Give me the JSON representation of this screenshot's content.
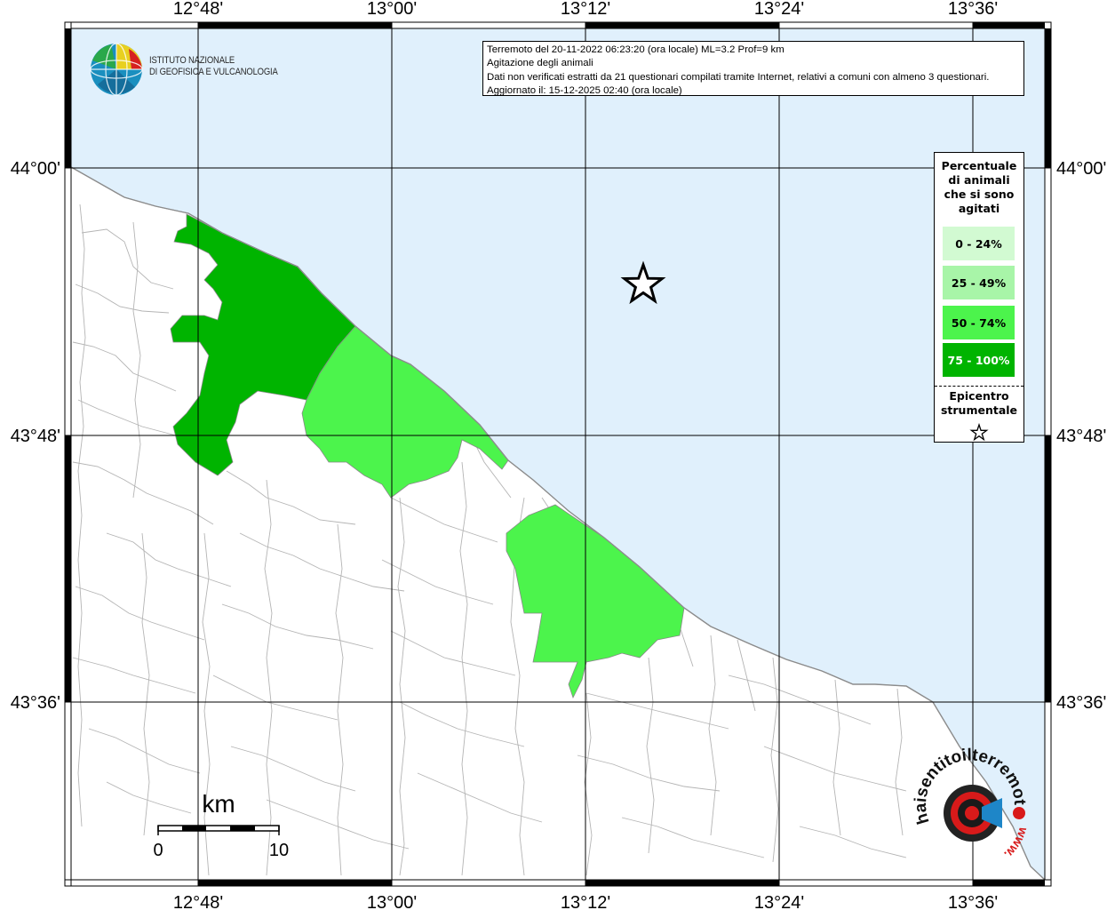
{
  "header": {
    "line1": "Terremoto del 20-11-2022 06:23:20 (ora locale) ML=3.2 Prof=9 km",
    "line2": "Agitazione degli animali",
    "line3": "Dati non verificati estratti da 21 questionari compilati tramite Internet, relativi a comuni con almeno 3 questionari.",
    "line4": "Aggiornato il: 15-12-2025 02:40 (ora locale)"
  },
  "logo": {
    "line1": "ISTITUTO NAZIONALE",
    "line2": "DI GEOFISICA E VULCANOLOGIA"
  },
  "legend": {
    "title_lines": [
      "Percentuale",
      "di animali",
      "che si sono",
      "agitati"
    ],
    "classes": [
      {
        "label": "0 - 24%",
        "color": "#d2fad2"
      },
      {
        "label": "25 - 49%",
        "color": "#a8f5a8"
      },
      {
        "label": "50 - 74%",
        "color": "#4cf44c"
      },
      {
        "label": "75 - 100%",
        "color": "#00b400"
      }
    ],
    "epicenter_lines": [
      "Epicentro",
      "strumentale"
    ]
  },
  "axes": {
    "top_ticks": [
      "12°48'",
      "13°00'",
      "13°12'",
      "13°24'",
      "13°36'"
    ],
    "bottom_ticks": [
      "12°48'",
      "13°00'",
      "13°12'",
      "13°24'",
      "13°36'"
    ],
    "left_ticks": [
      "44°00'",
      "43°48'",
      "43°36'"
    ],
    "right_ticks": [
      "44°00'",
      "43°48'",
      "43°36'"
    ]
  },
  "scale_bar": {
    "unit": "km",
    "start": "0",
    "end": "10"
  },
  "watermark": {
    "text": "haisentitoilterremoto.it",
    "www": "www."
  },
  "colors": {
    "sea": "#e0f0fc",
    "land": "#ffffff",
    "class_25_49": "#a8f5a8",
    "class_50_74": "#4cf44c",
    "class_75_100": "#00b400"
  }
}
